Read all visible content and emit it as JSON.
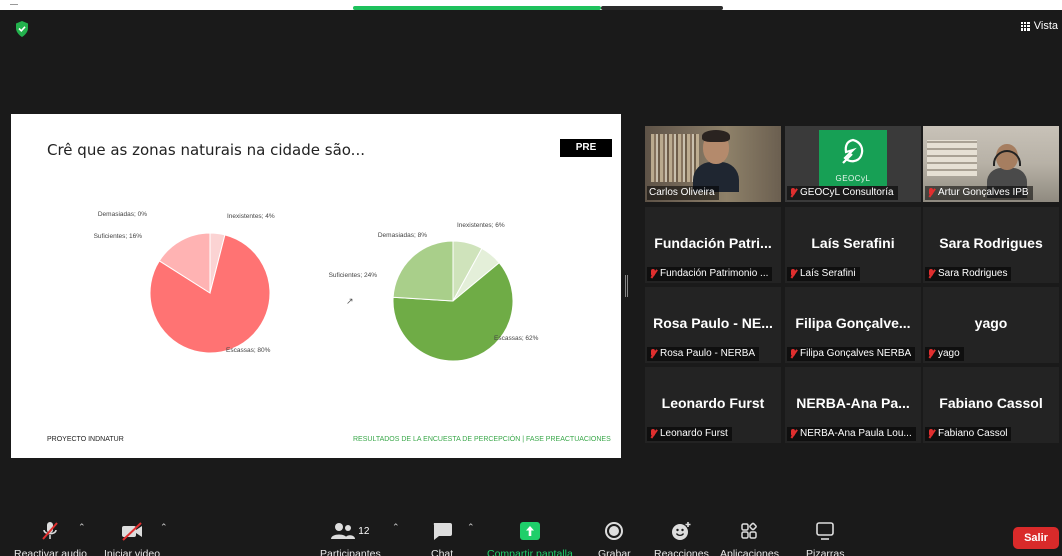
{
  "window": {
    "view_label": "Vista"
  },
  "slide": {
    "title": "Crê que as zonas naturais na cidade são...",
    "badge": "PRE",
    "footer_left": "PROYECTO INDNATUR",
    "footer_right": "RESULTADOS DE LA ENCUESTA DE PERCEPCIÓN | FASE PREACTUACIONES"
  },
  "chart_data": [
    {
      "type": "pie",
      "labels": [
        "Demasiadas",
        "Inexistentes",
        "Escassas",
        "Suficientes"
      ],
      "values": [
        0,
        4,
        80,
        16
      ],
      "data_labels": [
        "Demasiadas; 0%",
        "Inexistentes; 4%",
        "Escassas; 80%",
        "Suficientes; 16%"
      ],
      "colors": [
        "#f4b6b6",
        "#fbd3d3",
        "#ff7373",
        "#ffb3b3"
      ]
    },
    {
      "type": "pie",
      "labels": [
        "Demasiadas",
        "Inexistentes",
        "Escassas",
        "Suficientes"
      ],
      "values": [
        8,
        6,
        62,
        24
      ],
      "data_labels": [
        "Demasiadas; 8%",
        "Inexistentes; 6%",
        "Escassas; 62%",
        "Suficientes; 24%"
      ],
      "colors": [
        "#cfe3bb",
        "#e4efd9",
        "#6fac46",
        "#a9cf8a"
      ]
    }
  ],
  "participants": [
    {
      "name": "Carlos Oliveira",
      "label": "Carlos Oliveira",
      "muted": false,
      "active": true,
      "video": "carlos"
    },
    {
      "name": "GEOCyL Consultoría",
      "label": "GEOCyL Consultoría",
      "muted": true,
      "active": false,
      "video": "geocyl",
      "logo_text": "GEOCyL"
    },
    {
      "name": "Artur Gonçalves IPB",
      "label": "Artur Gonçalves IPB",
      "muted": true,
      "active": false,
      "video": "artur"
    },
    {
      "name": "Fundación Patri...",
      "label": "Fundación Patrimonio ...",
      "muted": true
    },
    {
      "name": "Laís Serafini",
      "label": "Laís Serafini",
      "muted": true
    },
    {
      "name": "Sara Rodrigues",
      "label": "Sara Rodrigues",
      "muted": true
    },
    {
      "name": "Rosa Paulo - NE...",
      "label": "Rosa Paulo - NERBA",
      "muted": true
    },
    {
      "name": "Filipa Gonçalve...",
      "label": "Filipa Gonçalves NERBA",
      "muted": true
    },
    {
      "name": "yago",
      "label": "yago",
      "muted": true
    },
    {
      "name": "Leonardo Furst",
      "label": "Leonardo Furst",
      "muted": true
    },
    {
      "name": "NERBA-Ana Pa...",
      "label": "NERBA-Ana Paula Lou...",
      "muted": true
    },
    {
      "name": "Fabiano Cassol",
      "label": "Fabiano Cassol",
      "muted": true
    }
  ],
  "toolbar": {
    "audio": "Reactivar audio",
    "video": "Iniciar video",
    "participants": "Participantes",
    "participants_count": "12",
    "chat": "Chat",
    "share": "Compartir pantalla",
    "record": "Grabar",
    "reactions": "Reacciones",
    "apps": "Aplicaciones",
    "whiteboards": "Pizarras",
    "leave": "Salir"
  }
}
